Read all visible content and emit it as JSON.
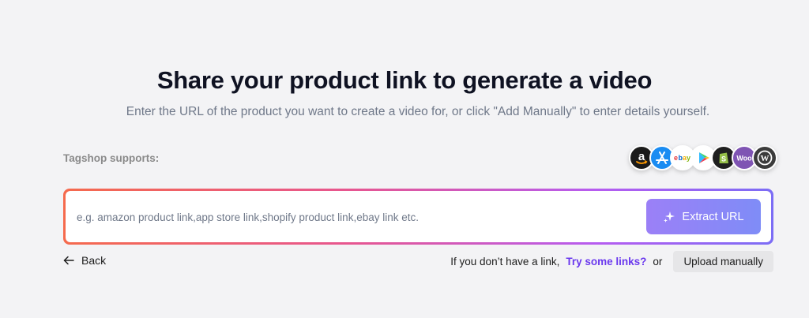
{
  "header": {
    "title": "Share your product link to generate a video",
    "subtitle": "Enter the URL of the product you want to create a video for, or click \"Add Manually\" to enter details yourself."
  },
  "supports": {
    "label": "Tagshop supports:",
    "platforms": [
      {
        "name": "amazon-logo-icon",
        "bg": "#1b1b1b"
      },
      {
        "name": "app-store-logo-icon",
        "bg": "#1a8cf2"
      },
      {
        "name": "ebay-logo-icon",
        "bg": "#ffffff"
      },
      {
        "name": "google-play-logo-icon",
        "bg": "#ffffff"
      },
      {
        "name": "shopify-logo-icon",
        "bg": "#1f1f1f"
      },
      {
        "name": "woocommerce-logo-icon",
        "bg": "#7f54b3"
      },
      {
        "name": "wordpress-logo-icon",
        "bg": "#3b3b3b"
      }
    ],
    "woo_text": "Woo"
  },
  "url_field": {
    "placeholder": "e.g. amazon product link,app store link,shopify product link,ebay link etc.",
    "value": ""
  },
  "extract_button": {
    "label": "Extract URL",
    "icon": "sparkle-icon"
  },
  "footer": {
    "back_label": "Back",
    "back_icon": "arrow-left-icon",
    "no_link_text": "If you don’t have a link,",
    "try_links_label": "Try some links?",
    "or_text": "or",
    "upload_label": "Upload manually"
  },
  "colors": {
    "accent": "#6a38ee",
    "button_gradient_start": "#9b80f7",
    "button_gradient_end": "#7f8cf7",
    "border_gradient_start": "#f56a4d",
    "border_gradient_end": "#7c6df5"
  }
}
